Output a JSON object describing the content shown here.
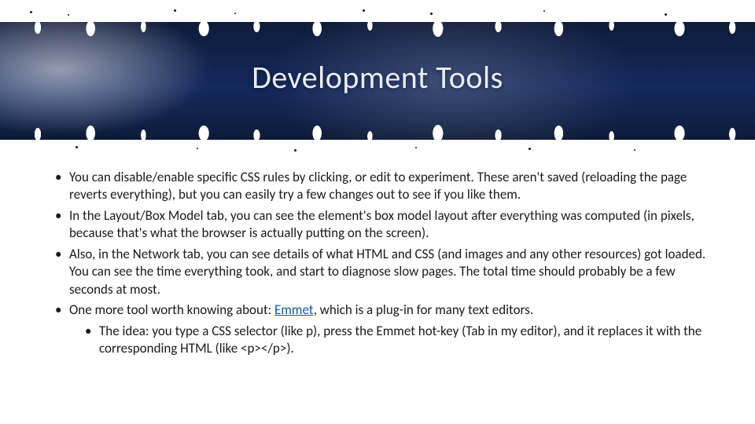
{
  "title": "Development Tools",
  "bullets": [
    {
      "text": "You can disable/enable specific CSS rules by clicking, or edit to experiment. These aren't saved (reloading the page reverts everything), but you can easily try a few changes out to see if you like them."
    },
    {
      "text": "In the Layout/Box Model tab, you can see the element's box model layout after everything was computed (in pixels, because that's what the browser is actually putting on the screen)."
    },
    {
      "text": "Also, in the Network tab, you can see details of what HTML and CSS (and images and any other resources) got loaded. You can see the time everything took, and start to diagnose slow pages. The total time should probably be a few seconds at most."
    },
    {
      "text_before_link": "One more tool worth knowing about: ",
      "link_text": "Emmet",
      "text_after_link": ", which is a plug-in for many text editors.",
      "children": [
        {
          "text": "The idea: you type a CSS selector (like p), press the Emmet hot-key (Tab in my editor), and it replaces it with the corresponding HTML (like <p></p>)."
        }
      ]
    }
  ],
  "colors": {
    "banner": "#12255a",
    "link": "#0b5cab"
  }
}
